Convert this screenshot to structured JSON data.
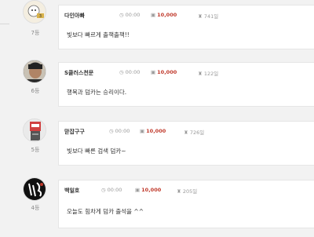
{
  "entries": [
    {
      "rank": "7등",
      "nickname": "다인아빠",
      "time": "00:00",
      "points": "10,000",
      "days": "741일",
      "message": "빛보다 빠르게 출책출책!!",
      "avatar_icon": "cartoon-avatar-icon"
    },
    {
      "rank": "6등",
      "nickname": "S클러스천문",
      "time": "00:00",
      "points": "10,000",
      "days": "122일",
      "message": "행복과 덤카는 승리이다.",
      "avatar_icon": "person-photo-avatar-icon"
    },
    {
      "rank": "5등",
      "nickname": "맏잡구구",
      "time": "00:00",
      "points": "10,000",
      "days": "726일",
      "message": "빛보다 빠른 검색 덤카~",
      "avatar_icon": "robot-avatar-icon"
    },
    {
      "rank": "4등",
      "nickname": "백일호",
      "time": "00:00",
      "points": "10,000",
      "days": "205일",
      "message": "오늘도 힘차게 덤카 출석을 ^^",
      "avatar_icon": "calligraphy-avatar-icon"
    }
  ],
  "icons": {
    "clock": "clock-icon",
    "gift": "gift-icon",
    "trophy": "trophy-icon"
  },
  "colors": {
    "points": "#c0392b",
    "card_border": "#e6e6e6",
    "background": "#f2f2f2"
  }
}
